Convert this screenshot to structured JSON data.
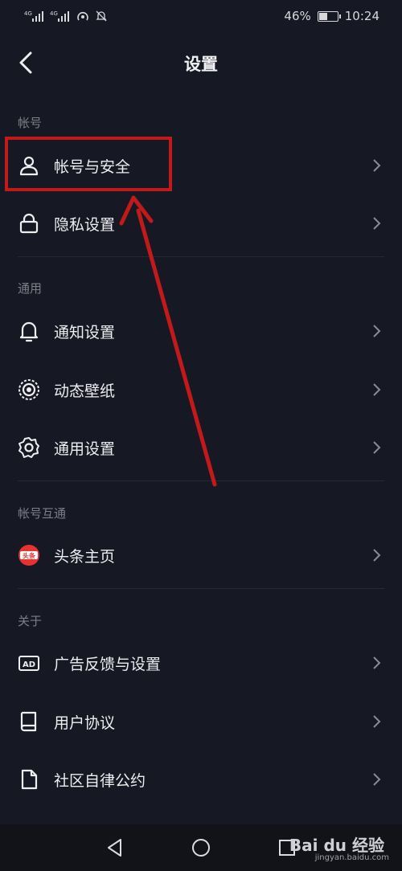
{
  "status_bar": {
    "battery": "46%",
    "battery_level": 0.46,
    "time": "10:24"
  },
  "header": {
    "title": "设置",
    "back_icon": "chevron-left-icon"
  },
  "sections": [
    {
      "label": "帐号",
      "items": [
        {
          "label": "帐号与安全",
          "icon": "user-icon"
        },
        {
          "label": "隐私设置",
          "icon": "lock-icon"
        }
      ]
    },
    {
      "label": "通用",
      "items": [
        {
          "label": "通知设置",
          "icon": "bell-icon"
        },
        {
          "label": "动态壁纸",
          "icon": "live-wallpaper-icon"
        },
        {
          "label": "通用设置",
          "icon": "gear-icon"
        }
      ]
    },
    {
      "label": "帐号互通",
      "items": [
        {
          "label": "头条主页",
          "icon": "toutiao-icon",
          "badge": "头条"
        }
      ]
    },
    {
      "label": "关于",
      "items": [
        {
          "label": "广告反馈与设置",
          "icon": "ad-icon",
          "badge": "AD"
        },
        {
          "label": "用户协议",
          "icon": "book-icon"
        },
        {
          "label": "社区自律公约",
          "icon": "document-icon"
        }
      ]
    }
  ],
  "watermark": {
    "brand": "Bai du 经验",
    "url": "jingyan.baidu.com"
  },
  "colors": {
    "background": "#161823",
    "highlight": "#c21a1a",
    "toutiao_red": "#e8322f"
  }
}
